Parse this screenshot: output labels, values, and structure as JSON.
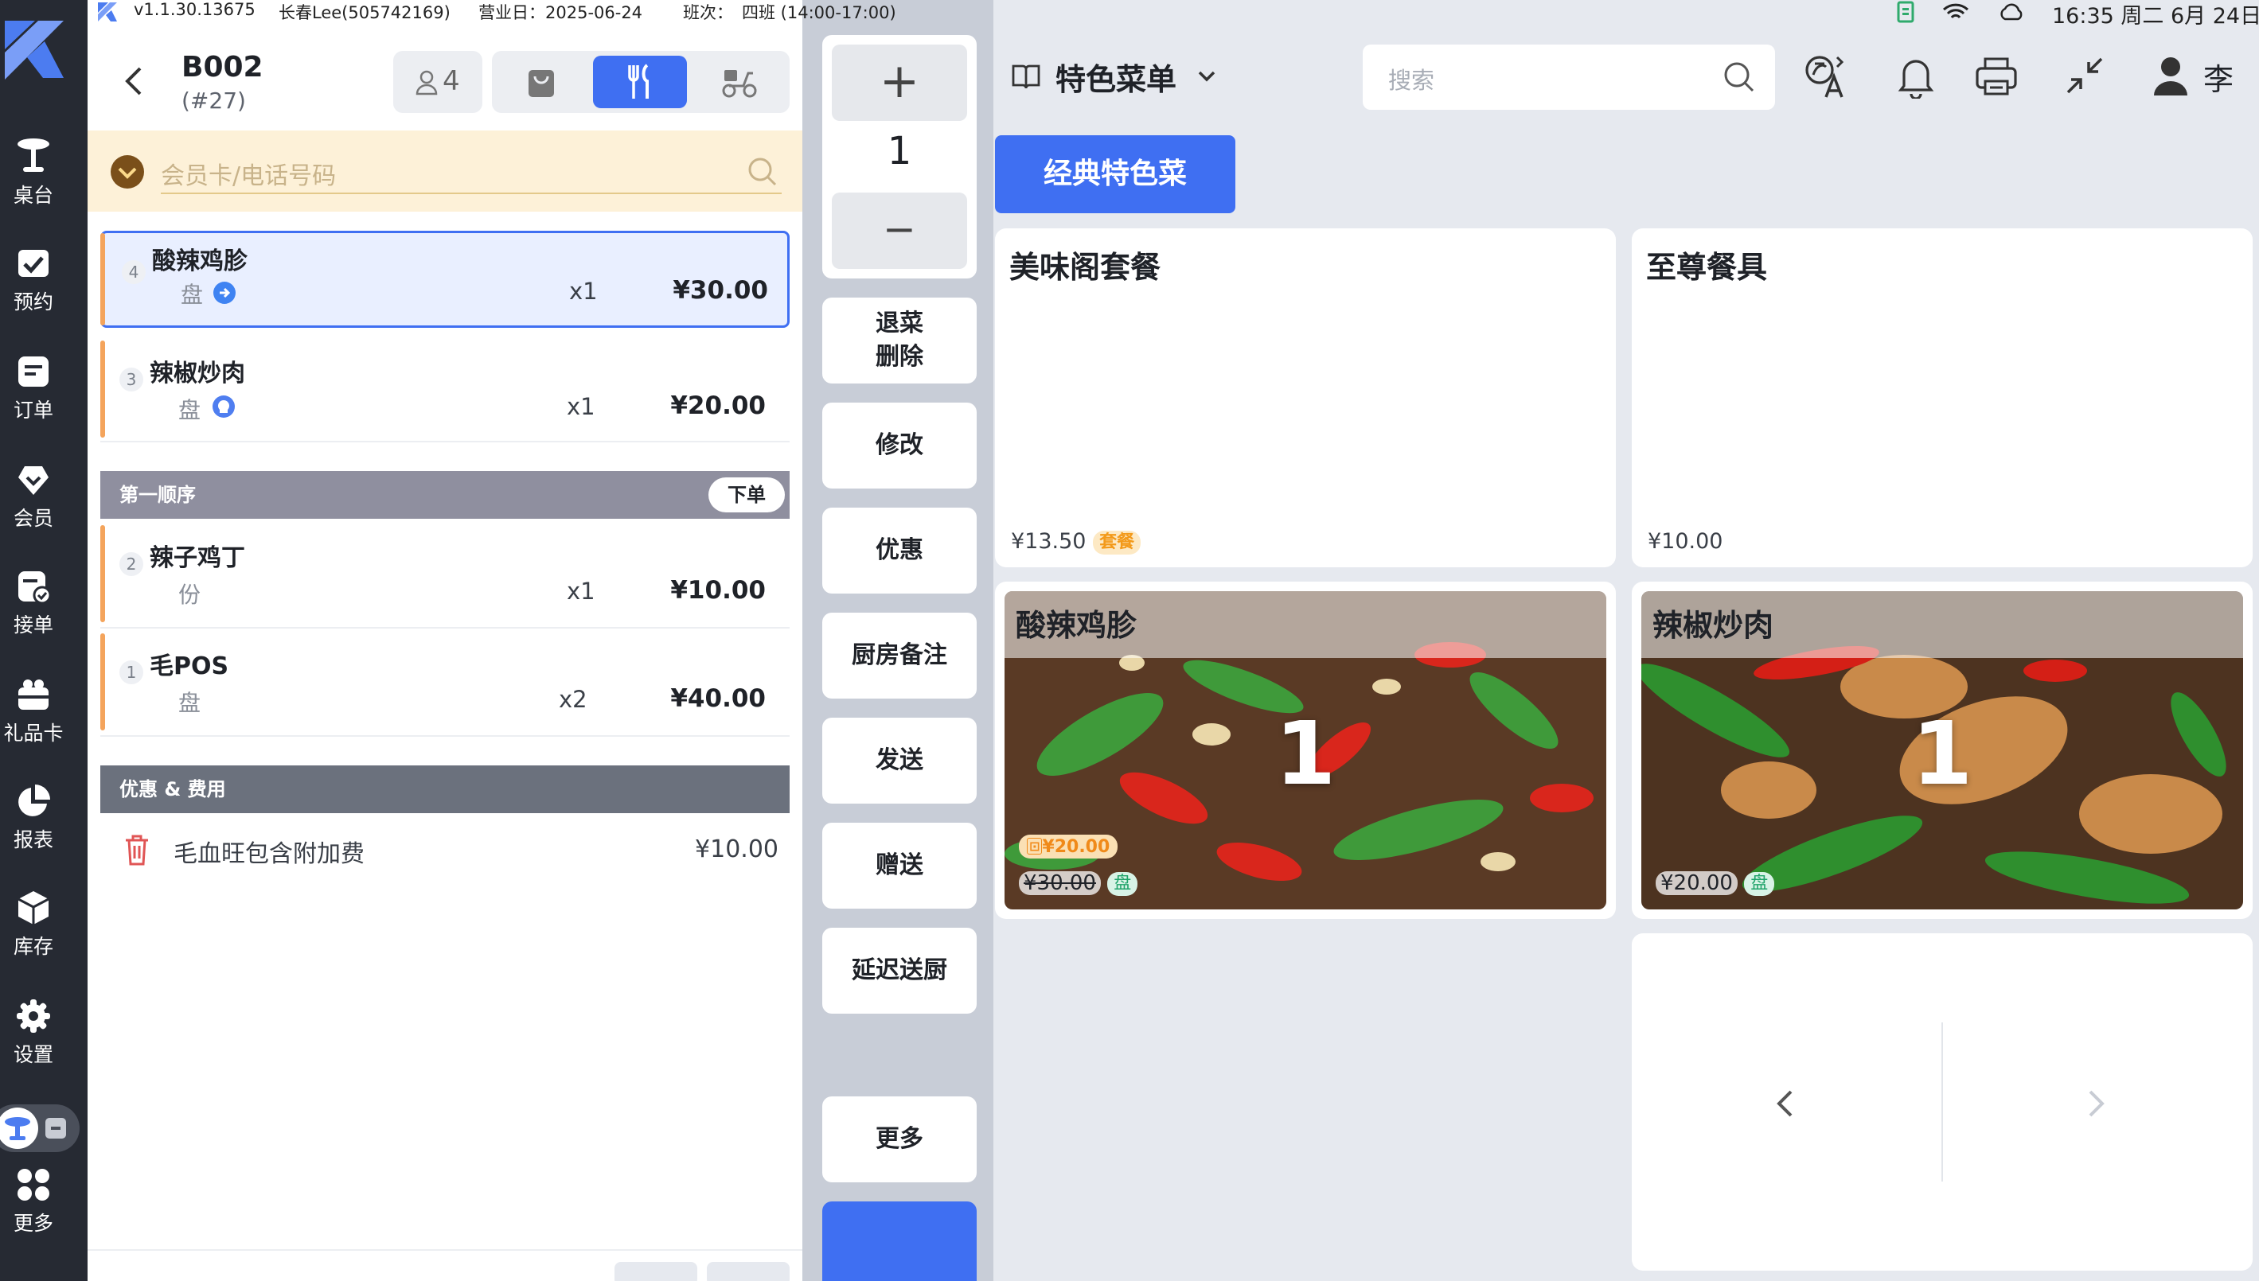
{
  "status": {
    "version": "v1.1.30.13675",
    "user": "长春Lee(505742169)",
    "bizdate": "营业日：2025-06-24",
    "shift_label": "班次：",
    "shift": "四班 (14:00-17:00)",
    "clock": "16:35 周二 6月 24日"
  },
  "sidebar": {
    "items": [
      {
        "label": "桌台",
        "icon": "table-icon"
      },
      {
        "label": "预约",
        "icon": "calendar-check-icon"
      },
      {
        "label": "订单",
        "icon": "order-icon"
      },
      {
        "label": "会员",
        "icon": "heart-icon"
      },
      {
        "label": "接单",
        "icon": "receive-order-icon"
      },
      {
        "label": "礼品卡",
        "icon": "gift-icon"
      },
      {
        "label": "报表",
        "icon": "pie-chart-icon"
      },
      {
        "label": "库存",
        "icon": "box-icon"
      },
      {
        "label": "设置",
        "icon": "gear-icon"
      },
      {
        "label": "更多",
        "icon": "grid-icon"
      }
    ]
  },
  "order": {
    "table": "B002",
    "serial": "(#27)",
    "guests": "4",
    "member_placeholder": "会员卡/电话号码",
    "items": [
      {
        "seq": "4",
        "name": "酸辣鸡胗",
        "unit": "盘",
        "qty": "x1",
        "price": "¥30.00"
      },
      {
        "seq": "3",
        "name": "辣椒炒肉",
        "unit": "盘",
        "qty": "x1",
        "price": "¥20.00"
      }
    ],
    "section": {
      "title": "第一顺序",
      "action": "下单",
      "items": [
        {
          "seq": "2",
          "name": "辣子鸡丁",
          "unit": "份",
          "qty": "x1",
          "price": "¥10.00"
        },
        {
          "seq": "1",
          "name": "毛POS",
          "unit": "盘",
          "qty": "x2",
          "price": "¥40.00"
        }
      ]
    },
    "fees": {
      "title": "优惠 & 费用",
      "name": "毛血旺包含附加费",
      "amount": "¥10.00"
    }
  },
  "ops": {
    "plus": "+",
    "count": "1",
    "minus": "−",
    "buttons": [
      {
        "label": "退菜\n删除"
      },
      {
        "label": "修改"
      },
      {
        "label": "优惠"
      },
      {
        "label": "厨房备注"
      },
      {
        "label": "发送"
      },
      {
        "label": "赠送"
      },
      {
        "label": "延迟送厨"
      },
      {
        "label": "更多"
      }
    ]
  },
  "menu": {
    "title": "特色菜单",
    "search_placeholder": "搜索",
    "user": "李",
    "category": "经典特色菜",
    "dishes": [
      {
        "name": "美味阁套餐",
        "price": "¥13.50",
        "tag": "套餐"
      },
      {
        "name": "至尊餐具",
        "price": "¥10.00"
      },
      {
        "name": "酸辣鸡胗",
        "qty": "1",
        "discount": "¥20.00",
        "price": "¥30.00",
        "tag": "盘"
      },
      {
        "name": "辣椒炒肉",
        "qty": "1",
        "price": "¥20.00",
        "tag": "盘"
      }
    ]
  },
  "colors": {
    "accent": "#3f6ff2",
    "sidebar": "#262a33",
    "member_bg": "#fdf1d8",
    "section_bg": "#8f8f9f",
    "fee_bg": "#6b717d",
    "orange": "#f4a45c"
  }
}
